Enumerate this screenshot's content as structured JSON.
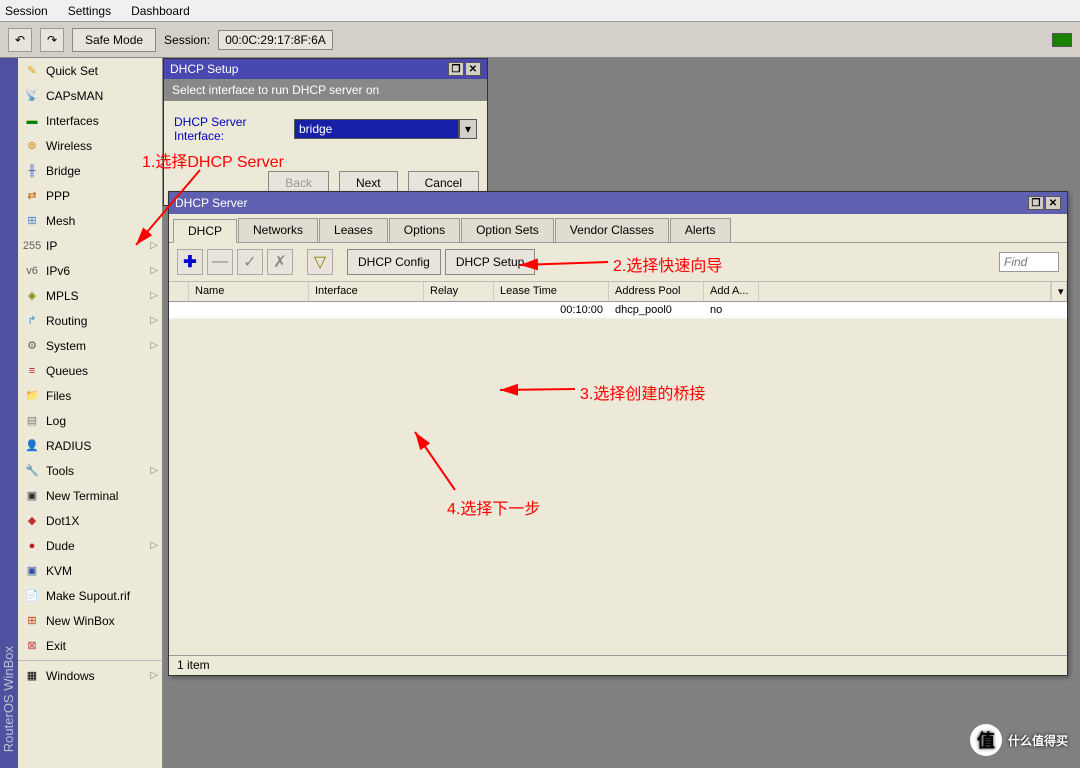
{
  "menu": {
    "session": "Session",
    "settings": "Settings",
    "dashboard": "Dashboard"
  },
  "toolbar": {
    "safe_mode": "Safe Mode",
    "session_label": "Session:",
    "session_value": "00:0C:29:17:8F:6A"
  },
  "vbar": "RouterOS WinBox",
  "sidebar": {
    "items": [
      {
        "label": "Quick Set",
        "icon": "✎",
        "color": "#e0a000"
      },
      {
        "label": "CAPsMAN",
        "icon": "📡",
        "color": "#888"
      },
      {
        "label": "Interfaces",
        "icon": "▬",
        "color": "#008000"
      },
      {
        "label": "Wireless",
        "icon": "⊚",
        "color": "#d08000"
      },
      {
        "label": "Bridge",
        "icon": "╫",
        "color": "#4060c0"
      },
      {
        "label": "PPP",
        "icon": "⇄",
        "color": "#c06000"
      },
      {
        "label": "Mesh",
        "icon": "⊞",
        "color": "#4080c0"
      },
      {
        "label": "IP",
        "icon": "255",
        "arrow": true,
        "color": "#606060"
      },
      {
        "label": "IPv6",
        "icon": "v6",
        "arrow": true,
        "color": "#606060"
      },
      {
        "label": "MPLS",
        "icon": "◈",
        "arrow": true,
        "color": "#808000"
      },
      {
        "label": "Routing",
        "icon": "↱",
        "arrow": true,
        "color": "#4090d0"
      },
      {
        "label": "System",
        "icon": "⚙",
        "arrow": true,
        "color": "#606060"
      },
      {
        "label": "Queues",
        "icon": "≡",
        "color": "#c02020"
      },
      {
        "label": "Files",
        "icon": "📁",
        "color": "#3060c0"
      },
      {
        "label": "Log",
        "icon": "▤",
        "color": "#808080"
      },
      {
        "label": "RADIUS",
        "icon": "👤",
        "color": "#e0a000"
      },
      {
        "label": "Tools",
        "icon": "🔧",
        "arrow": true,
        "color": "#606060"
      },
      {
        "label": "New Terminal",
        "icon": "▣",
        "color": "#303030"
      },
      {
        "label": "Dot1X",
        "icon": "◆",
        "color": "#c03030"
      },
      {
        "label": "Dude",
        "icon": "●",
        "arrow": true,
        "color": "#c02020"
      },
      {
        "label": "KVM",
        "icon": "▣",
        "color": "#3050a0"
      },
      {
        "label": "Make Supout.rif",
        "icon": "📄",
        "color": "#4080c0"
      },
      {
        "label": "New WinBox",
        "icon": "⊞",
        "color": "#c04000"
      },
      {
        "label": "Exit",
        "icon": "⊠",
        "color": "#c04040"
      }
    ],
    "windows": "Windows"
  },
  "dhcp_win": {
    "title": "DHCP Server",
    "tabs": [
      "DHCP",
      "Networks",
      "Leases",
      "Options",
      "Option Sets",
      "Vendor Classes",
      "Alerts"
    ],
    "buttons": {
      "config": "DHCP Config",
      "setup": "DHCP Setup"
    },
    "find_placeholder": "Find",
    "columns": [
      "Name",
      "Interface",
      "Relay",
      "Lease Time",
      "Address Pool",
      "Add A..."
    ],
    "row": {
      "lease_time": "00:10:00",
      "pool": "dhcp_pool0",
      "add": "no"
    },
    "status": "1 item"
  },
  "setup": {
    "title": "DHCP Setup",
    "sub": "Select interface to run DHCP server on",
    "label": "DHCP Server Interface:",
    "value": "bridge",
    "back": "Back",
    "next": "Next",
    "cancel": "Cancel"
  },
  "annot": {
    "a1": "1.选择DHCP Server",
    "a2": "2.选择快速向导",
    "a3": "3.选择创建的桥接",
    "a4": "4.选择下一步"
  },
  "watermark": "什么值得买"
}
